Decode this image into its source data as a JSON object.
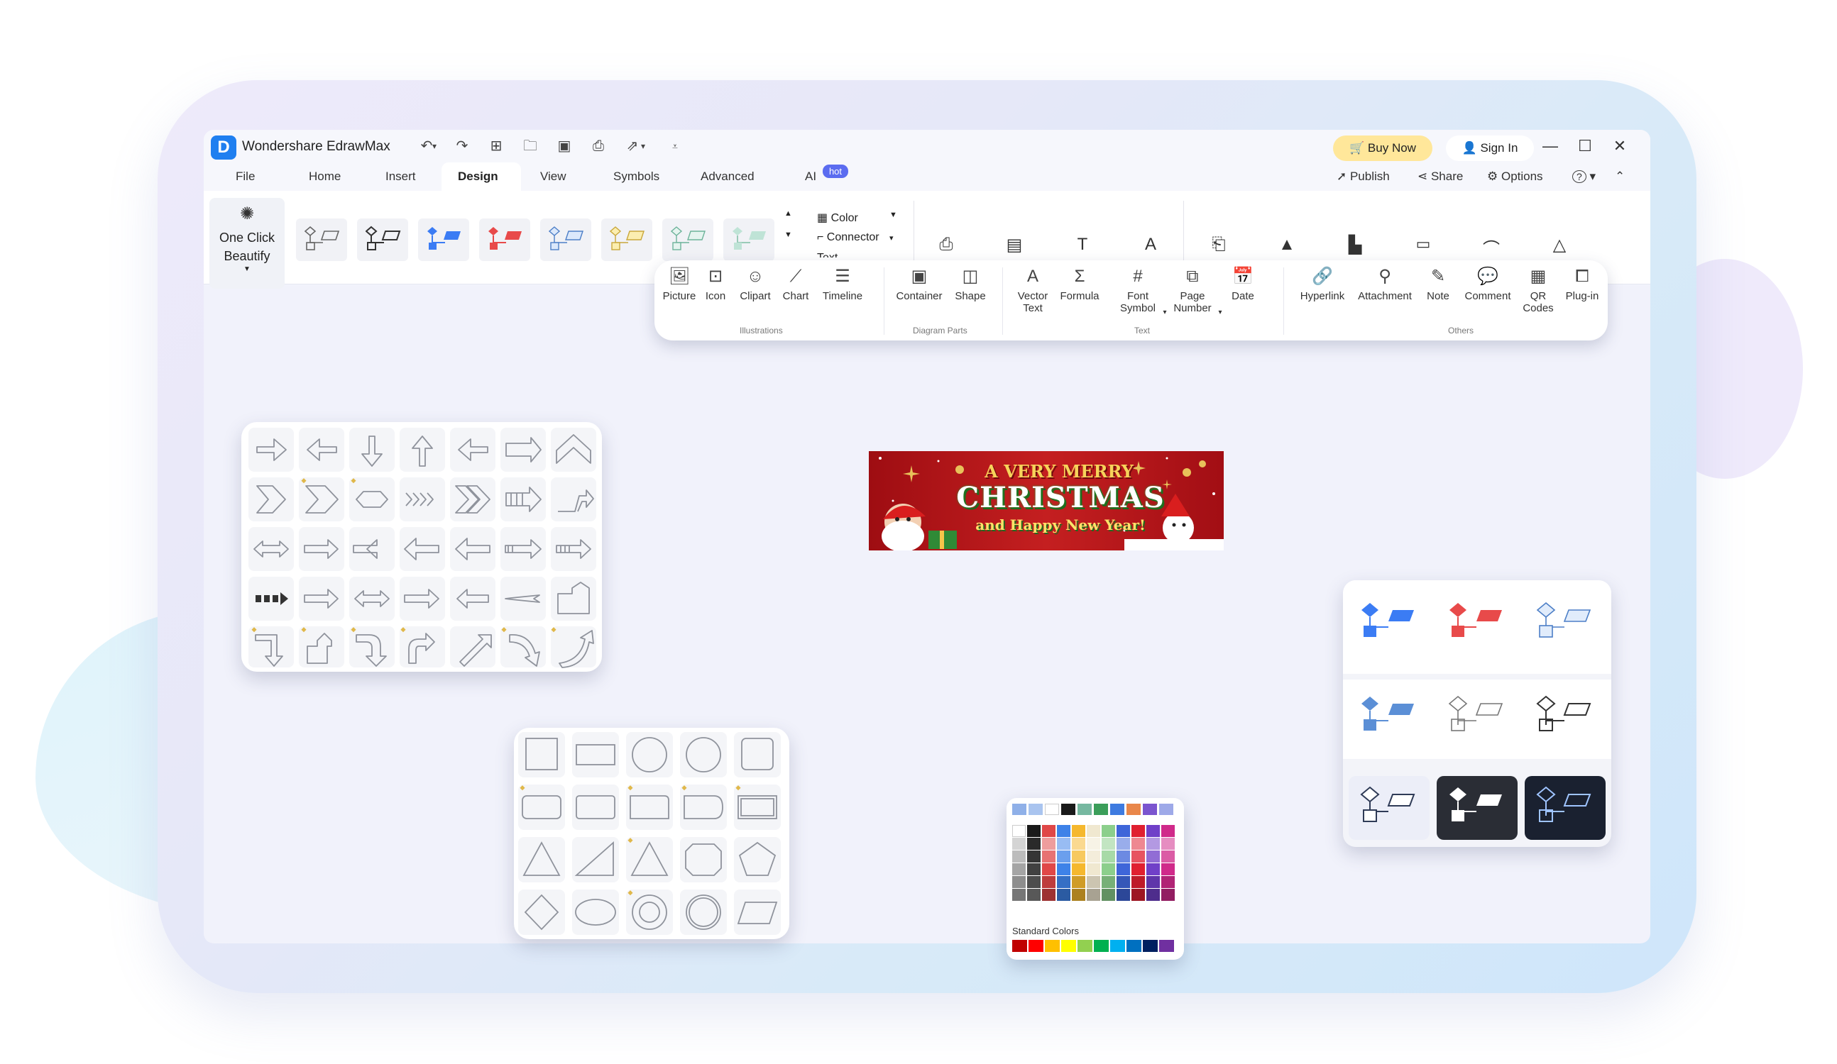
{
  "app": {
    "title": "Wondershare EdrawMax",
    "logo_letter": "D"
  },
  "titlebar": {
    "quick_icons": [
      "undo-icon",
      "redo-icon",
      "new-icon",
      "open-icon",
      "save-icon",
      "print-icon",
      "export-icon",
      "more-icon"
    ],
    "buy_now": "Buy Now",
    "sign_in": "Sign In"
  },
  "menu": {
    "tabs": [
      "File",
      "Home",
      "Insert",
      "Design",
      "View",
      "Symbols",
      "Advanced",
      "AI"
    ],
    "active": "Design",
    "ai_badge": "hot",
    "right": {
      "publish": "Publish",
      "share": "Share",
      "options": "Options",
      "help": "?"
    }
  },
  "ribbon": {
    "beautify": "One Click Beautify",
    "color": "Color",
    "connector": "Connector",
    "text": "Text"
  },
  "insert_toolbar": {
    "groups": {
      "illustrations": "Illustrations",
      "diagram_parts": "Diagram Parts",
      "text": "Text",
      "others": "Others"
    },
    "items": {
      "picture": "Picture",
      "icon": "Icon",
      "clipart": "Clipart",
      "chart": "Chart",
      "timeline": "Timeline",
      "container": "Container",
      "shape": "Shape",
      "vector_text_1": "Vector",
      "vector_text_2": "Text",
      "formula": "Formula",
      "font_symbol_1": "Font",
      "font_symbol_2": "Symbol",
      "page_number_1": "Page",
      "page_number_2": "Number",
      "date": "Date",
      "hyperlink": "Hyperlink",
      "attachment": "Attachment",
      "note": "Note",
      "comment": "Comment",
      "qr_1": "QR",
      "qr_2": "Codes",
      "plugin": "Plug-in"
    }
  },
  "banner": {
    "line1": "A VERY MERRY",
    "line2": "CHRISTMAS",
    "line3": "and Happy New Year!"
  },
  "color_picker": {
    "standard_label": "Standard Colors",
    "top_row": [
      "#8fb0e8",
      "#a9c4ef",
      "#ffffff",
      "#1a1a1a",
      "#76b8a0",
      "#3b9e5a",
      "#3e7be0",
      "#e9874a",
      "#7b55cf",
      "#9ea9e8"
    ],
    "base_row": [
      "#ffffff",
      "#1a1a1a",
      "#e04848",
      "#3e82e8",
      "#f5b82e",
      "#f0e8d0",
      "#8ccf8c",
      "#3f66d9",
      "#e02030",
      "#7040c8",
      "#d02a8a"
    ],
    "standard_colors": [
      "#c00000",
      "#ff0000",
      "#ffc000",
      "#ffff00",
      "#92d050",
      "#00b050",
      "#00b0f0",
      "#0070c0",
      "#002060",
      "#7030a0"
    ]
  },
  "accent": {
    "blue": "#3b7cf4",
    "red": "#e84a4a",
    "dark": "#1f2128",
    "buy_bg": "#ffe79a"
  }
}
